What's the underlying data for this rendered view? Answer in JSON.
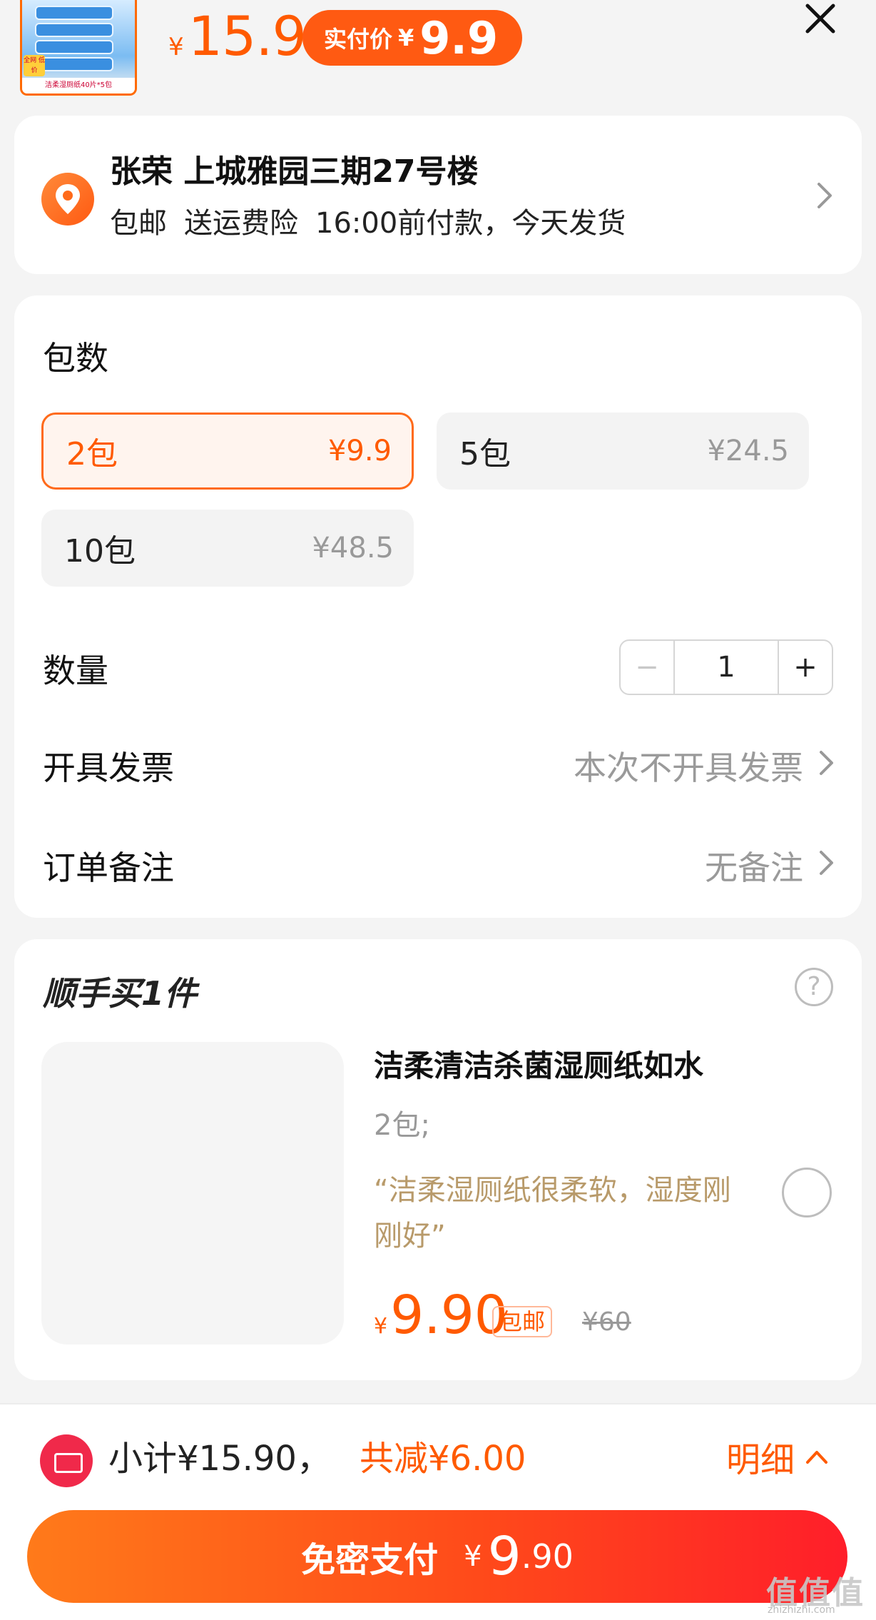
{
  "header": {
    "price_symbol": "¥",
    "price": "15.9",
    "real_price_label": "实付价",
    "real_price_symbol": "¥",
    "real_price": "9.9",
    "thumb_caption": "洁柔湿厕纸40片*5包",
    "thumb_tag": "全网 低价",
    "close_icon": "close-icon"
  },
  "address": {
    "name_line": "张荣 上城雅园三期27号楼",
    "tags": [
      "包邮",
      "送运费险",
      "16:00前付款，今天发货"
    ],
    "icon": "location-pin-icon"
  },
  "spec": {
    "label": "包数",
    "options": [
      {
        "name": "2包",
        "price": "¥9.9",
        "selected": true
      },
      {
        "name": "5包",
        "price": "¥24.5",
        "selected": false
      },
      {
        "name": "10包",
        "price": "¥48.5",
        "selected": false
      }
    ]
  },
  "quantity": {
    "label": "数量",
    "minus": "−",
    "value": "1",
    "plus": "+"
  },
  "invoice": {
    "label": "开具发票",
    "value": "本次不开具发票"
  },
  "remark": {
    "label": "订单备注",
    "value": "无备注"
  },
  "addon": {
    "title": "顺手买1件",
    "help_icon": "?",
    "product": {
      "title": "洁柔清洁杀菌湿厕纸如水",
      "spec": "2包;",
      "quote": "“洁柔湿厕纸很柔软，湿度刚刚好”",
      "price_symbol": "¥",
      "price": "9.90",
      "badge": "包邮",
      "original_price": "¥60"
    }
  },
  "footer": {
    "subtotal_label": "小计",
    "subtotal": "¥15.90，",
    "saved": "共减¥6.00",
    "detail_label": "明细",
    "pay_label": "免密支付",
    "pay_symbol": "¥",
    "pay_int": "9",
    "pay_dec": ".90"
  },
  "watermark": {
    "text": "值值值",
    "sub": "zhizhizhi.com"
  },
  "colors": {
    "accent": "#ff5a00",
    "pay_gradient_start": "#ff7a1a",
    "pay_gradient_end": "#ff1e2a",
    "quote": "#b89a6a"
  }
}
